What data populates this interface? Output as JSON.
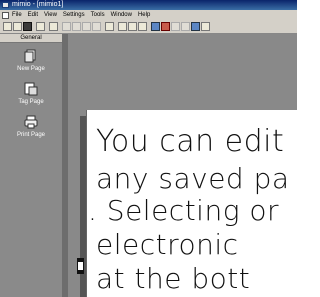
{
  "window": {
    "title": "mimio - [mimio1]"
  },
  "menubar": {
    "items": [
      "File",
      "Edit",
      "View",
      "Settings",
      "Tools",
      "Window",
      "Help"
    ]
  },
  "toolbar": {
    "buttons": [
      "new-icon",
      "open-icon",
      "save-icon",
      "print-icon",
      "print-preview-icon",
      "cut-icon",
      "copy-icon",
      "paste-icon",
      "delete-icon",
      "select-icon",
      "zoom-in-icon",
      "zoom-out-icon",
      "pointer-icon",
      "image-icon",
      "color-icon",
      "pen-icon",
      "highlighter-icon",
      "eraser-icon",
      "text-icon"
    ]
  },
  "sidebar": {
    "header": "General",
    "items": [
      {
        "label": "New Page",
        "icon": "new-page-icon"
      },
      {
        "label": "Tag Page",
        "icon": "tag-page-icon"
      },
      {
        "label": "Print Page",
        "icon": "print-page-icon"
      }
    ]
  },
  "canvas": {
    "ink_lines": [
      "You can edit",
      "any saved pa",
      ". Selecting or",
      "electronic",
      "at the bott"
    ]
  }
}
